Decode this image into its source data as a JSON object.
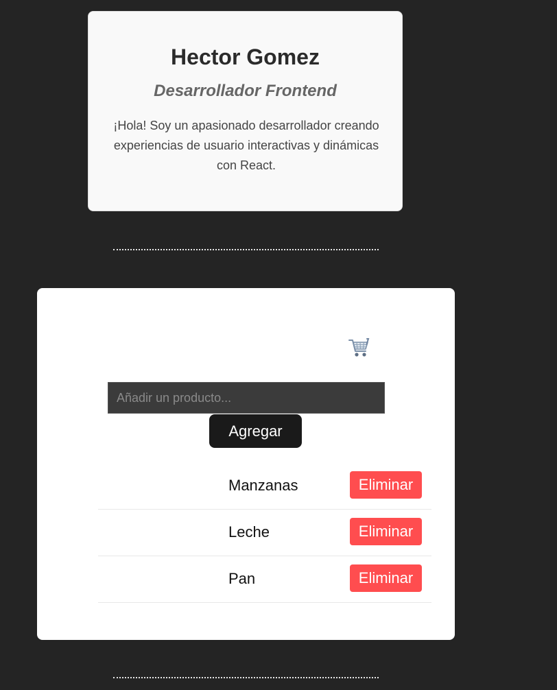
{
  "profile": {
    "name": "Hector Gomez",
    "role": "Desarrollador Frontend",
    "bio": "¡Hola! Soy un apasionado desarrollador creando experiencias de usuario interactivas y dinámicas con React."
  },
  "cart": {
    "icon": "shopping-cart-icon",
    "input": {
      "placeholder": "Añadir un producto...",
      "value": ""
    },
    "add_label": "Agregar",
    "items": [
      {
        "name": "Manzanas",
        "remove_label": "Eliminar"
      },
      {
        "name": "Leche",
        "remove_label": "Eliminar"
      },
      {
        "name": "Pan",
        "remove_label": "Eliminar"
      }
    ]
  },
  "colors": {
    "background": "#242424",
    "remove_button": "#ff4d4f",
    "add_button": "#1a1a1a"
  }
}
